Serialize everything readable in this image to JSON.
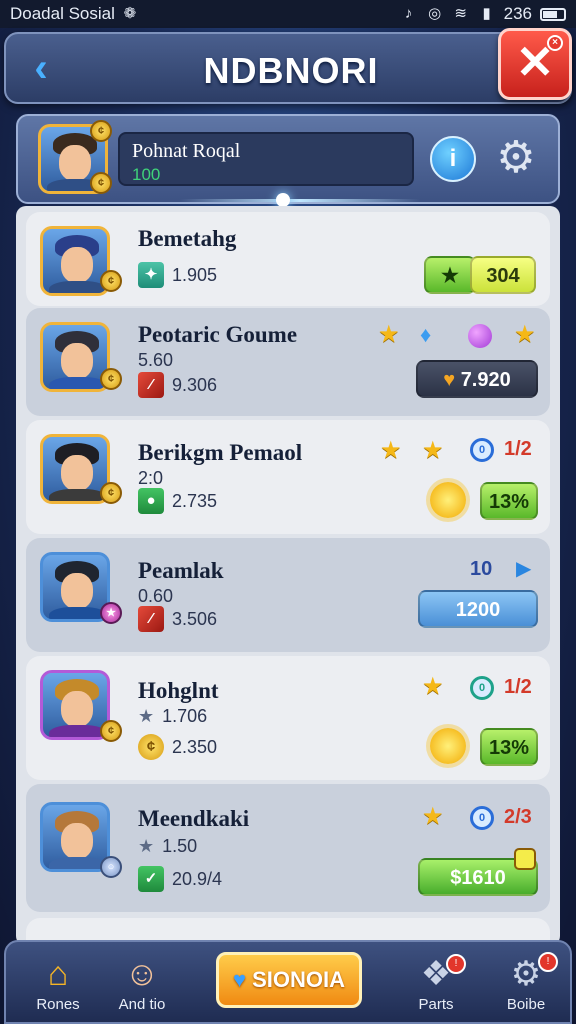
{
  "status_bar": {
    "app": "Doadal Sosial",
    "time": "236"
  },
  "header": {
    "title": "NDBNORI",
    "back_icon": "chevron-left-icon",
    "close_label": "✕"
  },
  "profile": {
    "name": "Pohnat Roqal",
    "value": "100"
  },
  "list": [
    {
      "name": "Bemetahg",
      "stat1": "1.905",
      "value": "304"
    },
    {
      "name": "Peotaric Goume",
      "stat1": "5.60",
      "stat2": "9.306",
      "value": "7.920"
    },
    {
      "name": "Berikgm Pemaol",
      "stat1": "2:0",
      "stat2": "2.735",
      "ratio": "1/2",
      "value": "13%"
    },
    {
      "name": "Peamlak",
      "stat1": "0.60",
      "stat2": "3.506",
      "count": "10",
      "value": "1200"
    },
    {
      "name": "Hohglnt",
      "stat1": "1.706",
      "stat2": "2.350",
      "ratio": "1/2",
      "value": "13%"
    },
    {
      "name": "Meendkaki",
      "stat1": "1.50",
      "stat2": "20.9/4",
      "ratio": "2/3",
      "value": "$1610"
    }
  ],
  "nav": {
    "home": "Rones",
    "friends": "And tio",
    "center": "SIONOIA",
    "pets": "Parts",
    "settings": "Boibe"
  }
}
